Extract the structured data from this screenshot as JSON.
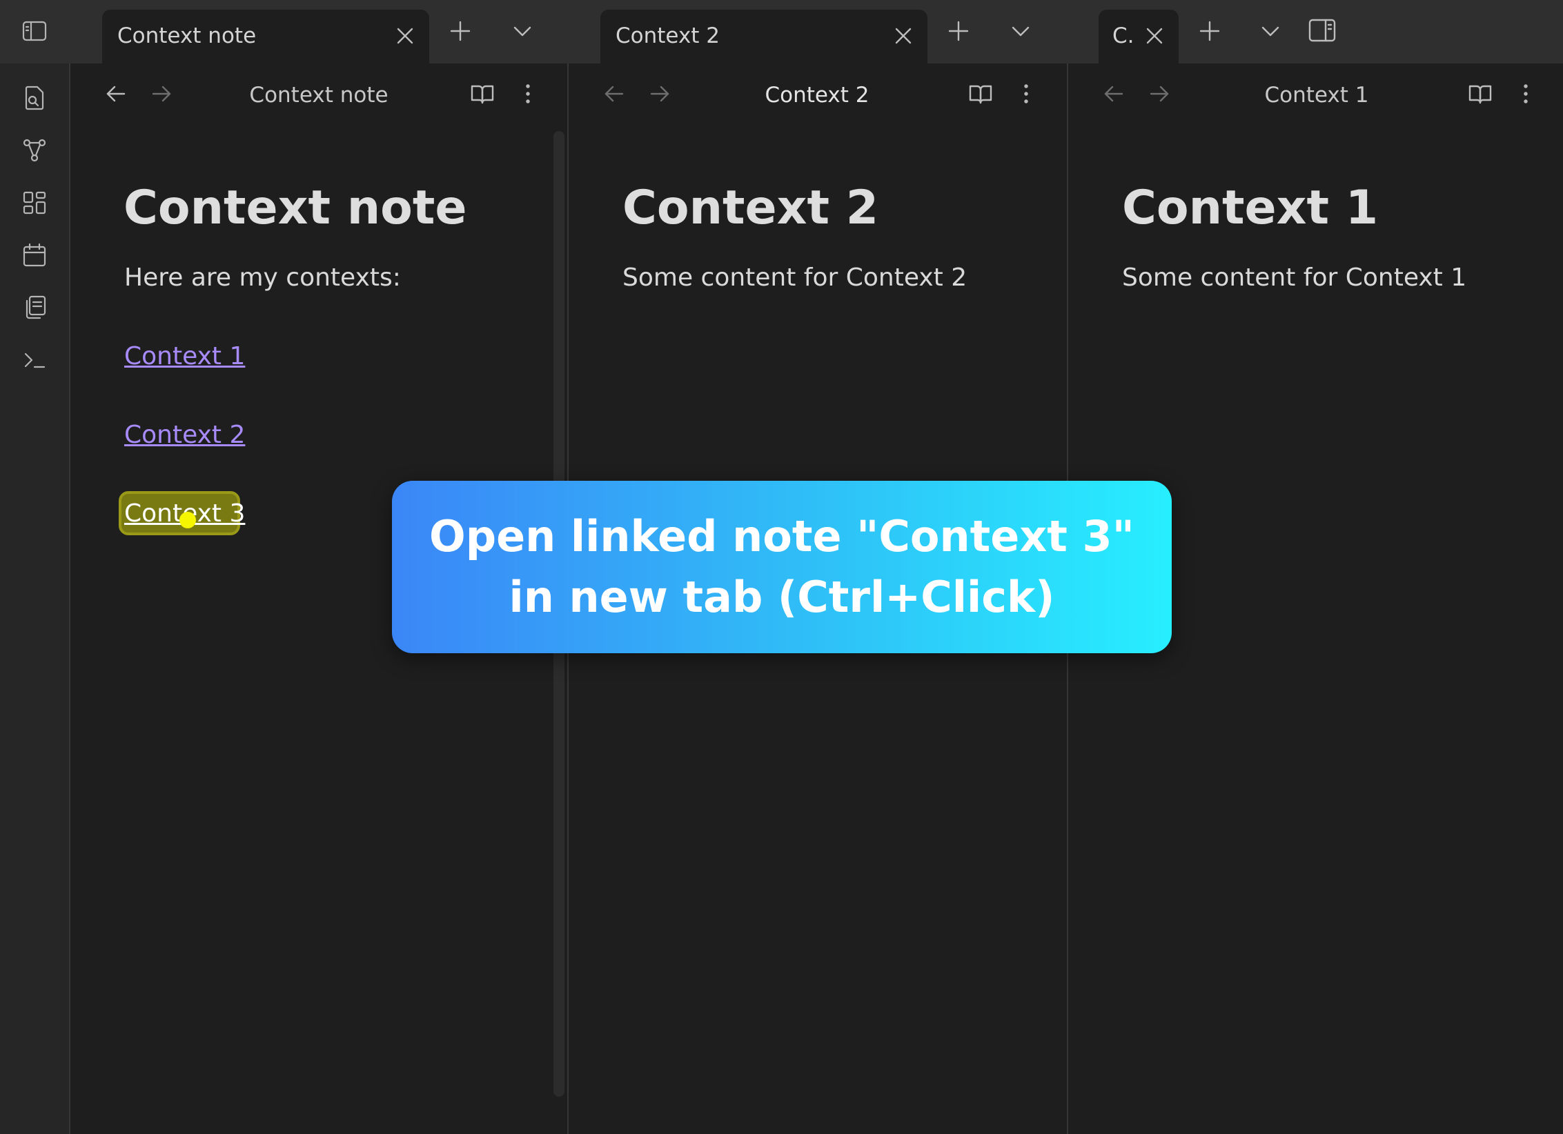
{
  "panes": [
    {
      "tab_title": "Context note",
      "header_title": "Context note",
      "heading": "Context note",
      "intro": "Here are my contexts:",
      "links": [
        "Context 1",
        "Context 2"
      ],
      "highlighted_link": "Context 3"
    },
    {
      "tab_title": "Context 2",
      "header_title": "Context 2",
      "heading": "Context 2",
      "body": "Some content for Context 2"
    },
    {
      "tab_title": "C.",
      "header_title": "Context 1",
      "heading": "Context 1",
      "body": "Some content for Context 1"
    }
  ],
  "banner": {
    "line1": "Open linked note \"Context 3\"",
    "line2": "in new tab (Ctrl+Click)"
  },
  "ribbon_icons": [
    "sidebar-toggle-icon",
    "quick-switch-icon",
    "graph-icon",
    "canvas-icon",
    "calendar-icon",
    "templates-icon",
    "terminal-icon"
  ],
  "colors": {
    "background": "#1e1e1e",
    "link": "#a88bfa",
    "highlight": "#7a7a12",
    "cursor": "#f6f600",
    "banner_start": "#3b86f7",
    "banner_end": "#27eeff"
  }
}
